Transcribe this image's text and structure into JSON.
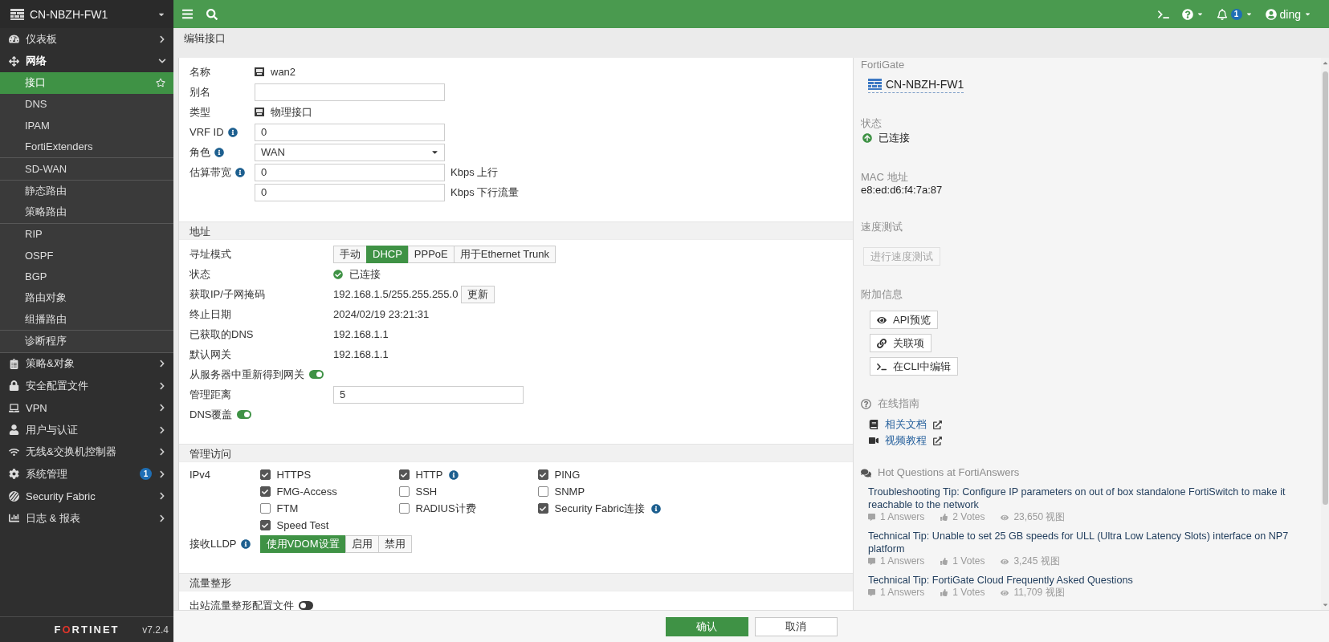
{
  "topbar": {
    "notifications": "1",
    "user": "ding"
  },
  "sidebar": {
    "device": "CN-NBZH-FW1",
    "items": [
      {
        "label": "仪表板",
        "expanded": false
      },
      {
        "label": "网络",
        "expanded": true,
        "groups": [
          {
            "items": [
              {
                "label": "接口",
                "selected": true
              },
              {
                "label": "DNS",
                "selected": false
              },
              {
                "label": "IPAM",
                "selected": false
              },
              {
                "label": "FortiExtenders",
                "selected": false
              }
            ]
          },
          {
            "items": [
              {
                "label": "SD-WAN",
                "selected": false
              }
            ]
          },
          {
            "items": [
              {
                "label": "静态路由",
                "selected": false
              },
              {
                "label": "策略路由",
                "selected": false
              }
            ]
          },
          {
            "items": [
              {
                "label": "RIP",
                "selected": false
              },
              {
                "label": "OSPF",
                "selected": false
              },
              {
                "label": "BGP",
                "selected": false
              },
              {
                "label": "路由对象",
                "selected": false
              },
              {
                "label": "组播路由",
                "selected": false
              }
            ]
          },
          {
            "items": [
              {
                "label": "诊断程序",
                "selected": false
              }
            ]
          }
        ]
      },
      {
        "label": "策略&对象",
        "expanded": false
      },
      {
        "label": "安全配置文件",
        "expanded": false
      },
      {
        "label": "VPN",
        "expanded": false
      },
      {
        "label": "用户与认证",
        "expanded": false
      },
      {
        "label": "无线&交换机控制器",
        "expanded": false
      },
      {
        "label": "系统管理",
        "expanded": false,
        "badge": "1"
      },
      {
        "label": "Security Fabric",
        "expanded": false
      },
      {
        "label": "日志 & 报表",
        "expanded": false
      }
    ],
    "brand": "FORTINET",
    "version": "v7.2.4"
  },
  "page_title": "编辑接口",
  "form": {
    "sections": [
      {
        "rows": [
          {
            "kind": "port",
            "label": "名称",
            "value": "wan2"
          },
          {
            "kind": "input",
            "label": "别名"
          },
          {
            "kind": "port",
            "label": "类型",
            "value": "物理接口"
          },
          {
            "kind": "input",
            "label": "VRF ID",
            "info": true,
            "value": "0"
          },
          {
            "kind": "select",
            "label": "角色",
            "info": true,
            "value": "WAN"
          },
          {
            "kind": "input",
            "label": "估算带宽",
            "info": true,
            "value": "0",
            "unit": "Kbps 上行"
          },
          {
            "kind": "input",
            "value": "0",
            "unit": "Kbps 下行流量"
          }
        ]
      },
      {
        "title": "地址",
        "rows": [
          {
            "kind": "segmented",
            "label": "寻址模式",
            "options": [
              {
                "label": "手动",
                "selected": false
              },
              {
                "label": "DHCP",
                "selected": true
              },
              {
                "label": "PPPoE",
                "selected": false
              },
              {
                "label": "用于Ethernet Trunk",
                "selected": false
              }
            ]
          },
          {
            "kind": "status",
            "label": "状态",
            "value": "已连接"
          },
          {
            "kind": "value_button",
            "label": "获取IP/子网掩码",
            "value": "192.168.1.5/255.255.255.0",
            "button": "更新"
          },
          {
            "kind": "value",
            "label": "终止日期",
            "value": "2024/02/19 23:21:31"
          },
          {
            "kind": "value",
            "label": "已获取的DNS",
            "value": "192.168.1.1"
          },
          {
            "kind": "value",
            "label": "默认网关",
            "value": "192.168.1.1"
          },
          {
            "kind": "toggle",
            "label": "从服务器中重新得到网关",
            "on": true
          },
          {
            "kind": "input",
            "label": "管理距离",
            "value": "5"
          },
          {
            "kind": "toggle",
            "label": "DNS覆盖",
            "on": true
          }
        ]
      },
      {
        "title": "管理访问",
        "rows": [
          {
            "kind": "checkboxes",
            "label": "IPv4",
            "options": [
              {
                "label": "HTTPS",
                "checked": true
              },
              {
                "label": "HTTP",
                "checked": true,
                "info": true
              },
              {
                "label": "PING",
                "checked": true
              },
              {
                "label": "FMG-Access",
                "checked": true
              },
              {
                "label": "SSH",
                "checked": false
              },
              {
                "label": "SNMP",
                "checked": false
              },
              {
                "label": "FTM",
                "checked": false
              },
              {
                "label": "RADIUS计费",
                "checked": false
              },
              {
                "label": "Security Fabric连接",
                "checked": true,
                "info": true
              },
              {
                "label": "Speed Test",
                "checked": true
              }
            ]
          },
          {
            "kind": "segmented",
            "label": "接收LLDP",
            "info": true,
            "options": [
              {
                "label": "使用VDOM设置",
                "selected": true
              },
              {
                "label": "启用",
                "selected": false
              },
              {
                "label": "禁用",
                "selected": false
              }
            ]
          }
        ]
      },
      {
        "title": "流量整形",
        "rows": [
          {
            "kind": "toggle",
            "label": "出站流量整形配置文件",
            "on": false
          }
        ]
      }
    ]
  },
  "footer": {
    "buttons": [
      {
        "label": "确认",
        "kind": "primary"
      },
      {
        "label": "取消",
        "kind": "secondary"
      }
    ]
  },
  "info_panel": {
    "device": {
      "label": "FortiGate",
      "value": "CN-NBZH-FW1"
    },
    "status": {
      "label": "状态",
      "value": "已连接"
    },
    "mac": {
      "label": "MAC 地址",
      "value": "e8:ed:d6:f4:7a:87"
    },
    "speed_test": {
      "label": "速度测试",
      "button": "进行速度测试",
      "disabled": true
    },
    "additional": {
      "label": "附加信息",
      "buttons": [
        "API预览",
        "关联项",
        "在CLI中编辑"
      ]
    },
    "guide": {
      "label": "在线指南",
      "links": [
        "相关文档",
        "视频教程"
      ]
    },
    "questions": {
      "label": "Hot Questions at FortiAnswers",
      "items": [
        {
          "title": "Troubleshooting Tip: Configure IP parameters on out of box standalone FortiSwitch to make it reachable to the network",
          "answers": "1 Answers",
          "votes": "2 Votes",
          "views": "23,650 视图"
        },
        {
          "title": "Technical Tip: Unable to set 25 GB speeds for ULL (Ultra Low Latency Slots) interface on NP7 platform",
          "answers": "1 Answers",
          "votes": "1 Votes",
          "views": "3,245 视图"
        },
        {
          "title": "Technical Tip: FortiGate Cloud Frequently Asked Questions",
          "answers": "1 Answers",
          "votes": "1 Votes",
          "views": "11,709 视图"
        }
      ]
    }
  }
}
